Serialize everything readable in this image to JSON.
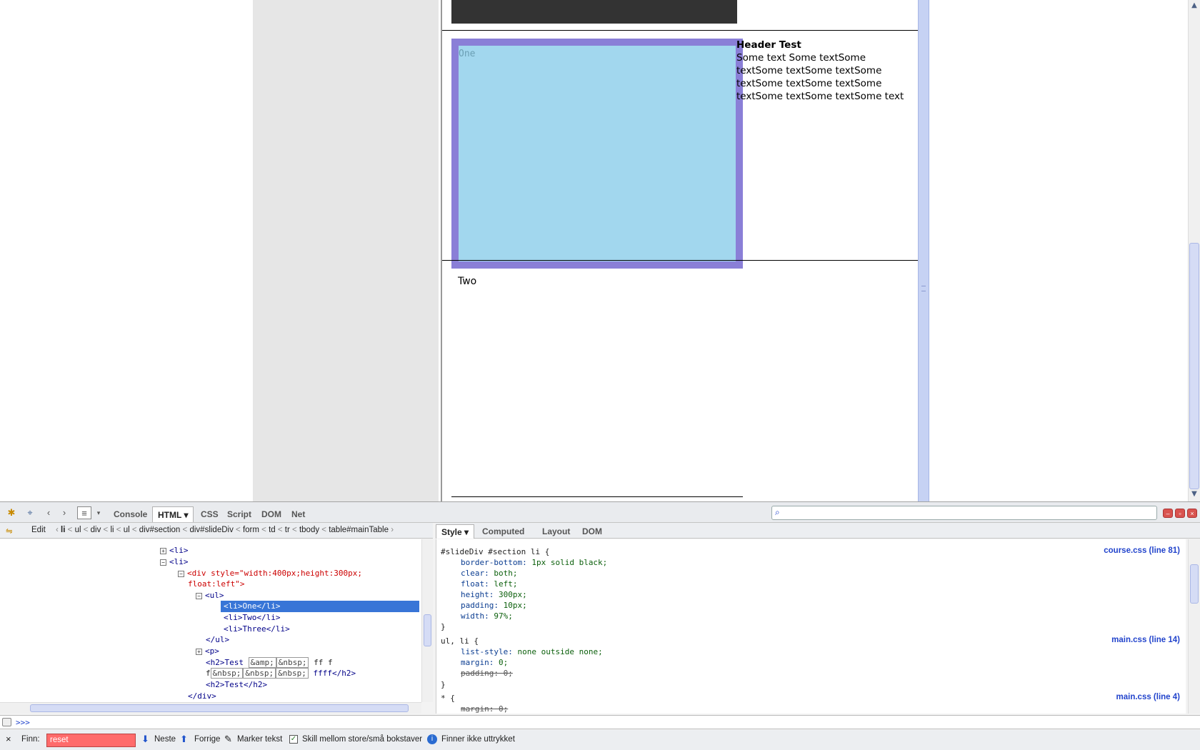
{
  "page": {
    "li_one_label": "One",
    "side_heading": "Header Test",
    "side_text": "Some text Some textSome textSome textSome textSome textSome textSome textSome textSome textSome textSome text",
    "li_two_label": "Two"
  },
  "firebug": {
    "tabs": [
      "Console",
      "HTML",
      "CSS",
      "Script",
      "DOM",
      "Net"
    ],
    "active_tab": "HTML",
    "edit_label": "Edit",
    "breadcrumb": [
      "li",
      "ul",
      "div",
      "li",
      "ul",
      "div#section",
      "div#slideDiv",
      "form",
      "td",
      "tr",
      "tbody",
      "table#mainTable"
    ],
    "side_tabs": [
      "Style",
      "Computed",
      "Layout",
      "DOM"
    ],
    "active_side_tab": "Style",
    "html_lines": {
      "l1": "<li>",
      "l2": "<li>",
      "l3a": "<div style=\"width:400px;height:300px;",
      "l3b": "float:left\">",
      "l4": "<ul>",
      "l5": "<li>One</li>",
      "l6": "<li>Two</li>",
      "l7": "<li>Three</li>",
      "l8": "</ul>",
      "l9": "<p>",
      "l10a": "<h2>Test",
      "l10_ent1": "&amp;",
      "l10_ent2": "&nbsp;",
      "l10b": "ff f",
      "l11a": "f",
      "l11_ent": "&nbsp;",
      "l11b": "ffff</h2>",
      "l12": "<h2>Test</h2>",
      "l13": "</div>"
    },
    "style_rules": {
      "r1_selector": "#slideDiv #section li {",
      "r1_source": "course.css (line 81)",
      "r1_props": [
        {
          "name": "border-bottom:",
          "value": "1px solid black;"
        },
        {
          "name": "clear:",
          "value": "both;"
        },
        {
          "name": "float:",
          "value": "left;"
        },
        {
          "name": "height:",
          "value": "300px;"
        },
        {
          "name": "padding:",
          "value": "10px;"
        },
        {
          "name": "width:",
          "value": "97%;"
        }
      ],
      "close": "}",
      "r2_selector": "ul, li {",
      "r2_source": "main.css (line 14)",
      "r2_props": [
        {
          "name": "list-style:",
          "value": "none outside none;"
        },
        {
          "name": "margin:",
          "value": "0;"
        },
        {
          "name": "padding:",
          "value": "0;"
        }
      ],
      "r3_selector": "* {",
      "r3_source": "main.css (line 4)",
      "r3_props": [
        {
          "name": "margin:",
          "value": "0;"
        }
      ]
    },
    "command_prompt": ">>>",
    "find": {
      "label": "Finn:",
      "value": "reset",
      "next": "Neste",
      "prev": "Forrige",
      "highlight": "Marker tekst",
      "match_case": "Skill mellom store/små bokstaver",
      "status": "Finner ikke uttrykket"
    }
  }
}
